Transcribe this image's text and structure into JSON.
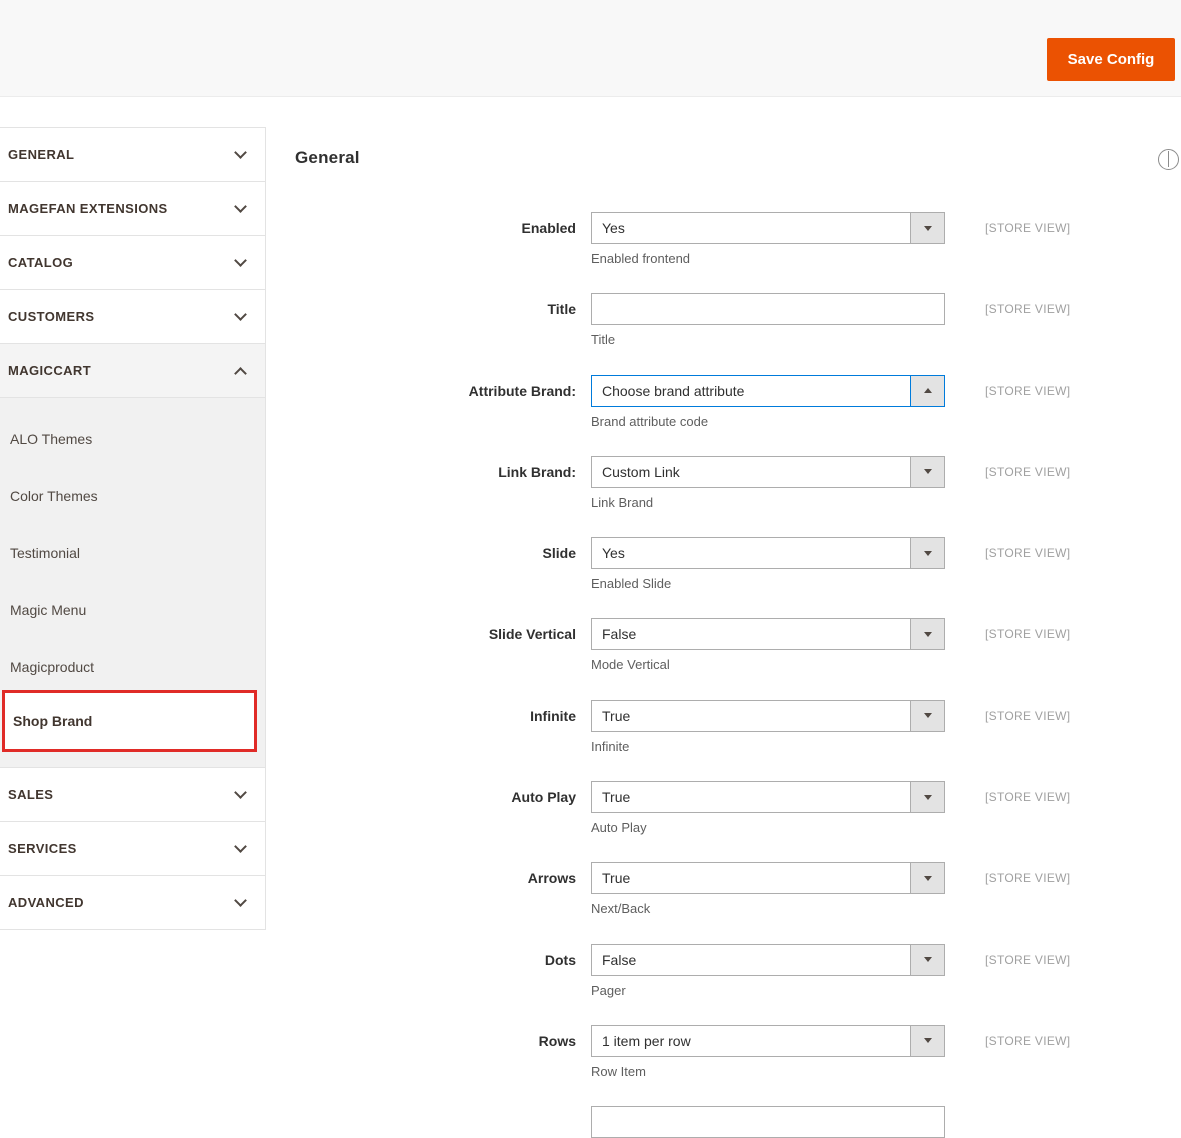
{
  "header": {
    "save_button": "Save Config"
  },
  "main": {
    "section_title": "General",
    "collapse_icon": "chevron-up-circle-icon"
  },
  "colors": {
    "primary_button": "#eb5202",
    "focus_border": "#007bdb",
    "annotation_red": "#e02b27",
    "field_border": "#adadad",
    "submenu_bg": "#f1f1f1"
  },
  "sidebar": {
    "sections": [
      {
        "label": "GENERAL",
        "state": "collapsed"
      },
      {
        "label": "MAGEFAN EXTENSIONS",
        "state": "collapsed"
      },
      {
        "label": "CATALOG",
        "state": "collapsed"
      },
      {
        "label": "CUSTOMERS",
        "state": "collapsed"
      }
    ],
    "magiccart": {
      "label": "MAGICCART",
      "state": "expanded"
    },
    "subitems": [
      {
        "label": "ALO Themes"
      },
      {
        "label": "Color Themes"
      },
      {
        "label": "Testimonial"
      },
      {
        "label": "Magic Menu"
      },
      {
        "label": "Magicproduct"
      }
    ],
    "active_subitem": {
      "label": "Shop Brand",
      "highlighted": true
    },
    "bottom_sections": [
      {
        "label": "SALES",
        "state": "collapsed"
      },
      {
        "label": "SERVICES",
        "state": "collapsed"
      },
      {
        "label": "ADVANCED",
        "state": "collapsed"
      }
    ]
  },
  "form": {
    "rows": [
      {
        "label": "Enabled",
        "type": "select",
        "value": "Yes",
        "helper": "Enabled frontend",
        "scope": "[STORE VIEW]"
      },
      {
        "label": "Title",
        "type": "text",
        "value": "",
        "helper": "Title",
        "scope": "[STORE VIEW]"
      },
      {
        "label": "Attribute Brand:",
        "type": "select",
        "value": "Choose brand attribute",
        "helper": "Brand attribute code",
        "scope": "[STORE VIEW]",
        "focused": true,
        "open": true
      },
      {
        "label": "Link Brand:",
        "type": "select",
        "value": "Custom Link",
        "helper": "Link Brand",
        "scope": "[STORE VIEW]"
      },
      {
        "label": "Slide",
        "type": "select",
        "value": "Yes",
        "helper": "Enabled Slide",
        "scope": "[STORE VIEW]"
      },
      {
        "label": "Slide Vertical",
        "type": "select",
        "value": "False",
        "helper": "Mode Vertical",
        "scope": "[STORE VIEW]"
      },
      {
        "label": "Infinite",
        "type": "select",
        "value": "True",
        "helper": "Infinite",
        "scope": "[STORE VIEW]"
      },
      {
        "label": "Auto Play",
        "type": "select",
        "value": "True",
        "helper": "Auto Play",
        "scope": "[STORE VIEW]"
      },
      {
        "label": "Arrows",
        "type": "select",
        "value": "True",
        "helper": "Next/Back",
        "scope": "[STORE VIEW]"
      },
      {
        "label": "Dots",
        "type": "select",
        "value": "False",
        "helper": "Pager",
        "scope": "[STORE VIEW]"
      },
      {
        "label": "Rows",
        "type": "select",
        "value": "1 item per row",
        "helper": "Row Item",
        "scope": "[STORE VIEW]"
      }
    ]
  }
}
